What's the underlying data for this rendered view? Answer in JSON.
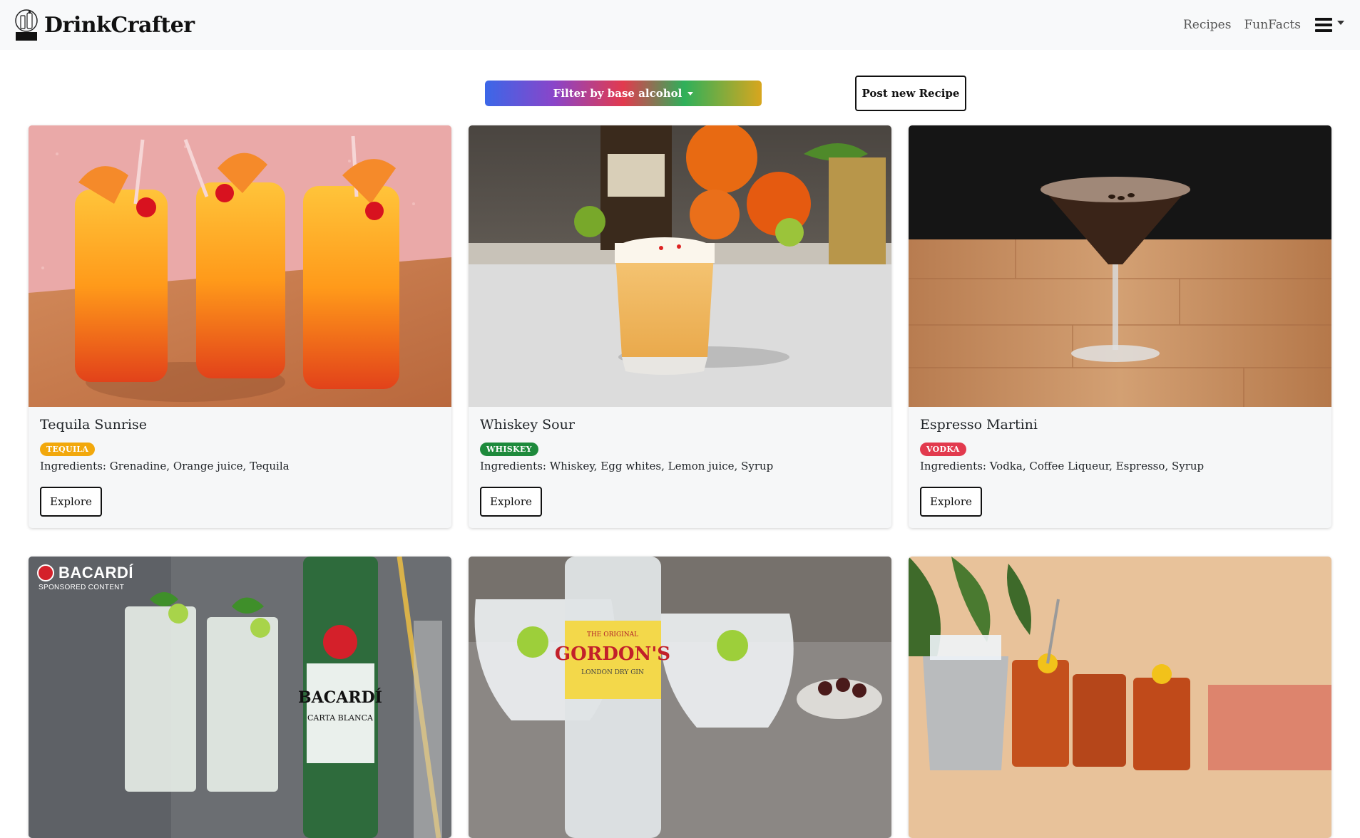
{
  "brand": {
    "name": "DrinkCrafter",
    "logo_label": "DRINK CRAFTER"
  },
  "nav": {
    "links": [
      "Recipes",
      "FunFacts"
    ],
    "menu_icon": "hamburger-icon"
  },
  "toolbar": {
    "filter_label": "Filter by base alcohol",
    "post_label": "Post new Recipe"
  },
  "colors": {
    "tequila": "#f2a80c",
    "whiskey": "#1e8a3c",
    "vodka": "#e23a4e"
  },
  "cards": [
    {
      "title": "Tequila Sunrise",
      "badge": "TEQUILA",
      "ingredients": "Ingredients: Grenadine, Orange juice, Tequila",
      "button": "Explore"
    },
    {
      "title": "Whiskey Sour",
      "badge": "WHISKEY",
      "ingredients": "Ingredients: Whiskey, Egg whites, Lemon juice, Syrup",
      "button": "Explore"
    },
    {
      "title": "Espresso Martini",
      "badge": "VODKA",
      "ingredients": "Ingredients: Vodka, Coffee Liqueur, Espresso, Syrup",
      "button": "Explore"
    }
  ],
  "bottom_cards": [
    {
      "sponsor_name": "BACARDÍ",
      "sponsor_sub": "SPONSORED CONTENT",
      "label_main": "BACARDÍ",
      "label_sub": "CARTA BLANCA"
    },
    {
      "label_top": "THE ORIGINAL",
      "label_main": "GORDON'S",
      "label_sub": "LONDON DRY GIN"
    },
    {}
  ]
}
